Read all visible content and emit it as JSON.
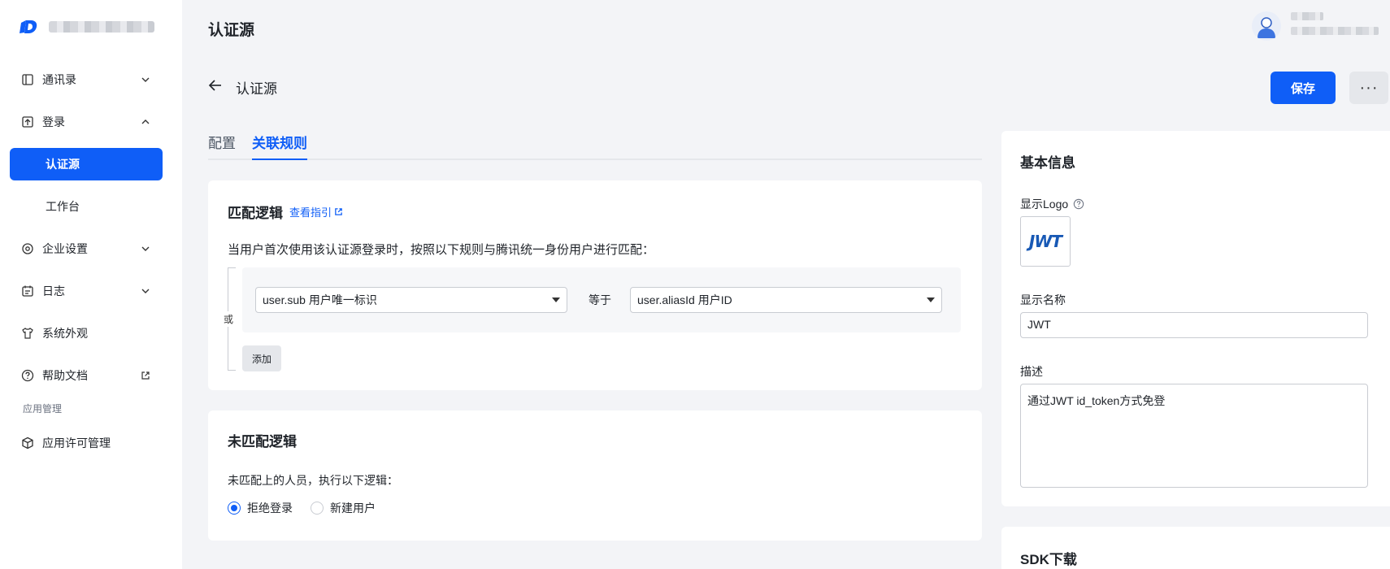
{
  "sidebar": {
    "items": [
      {
        "label": "通讯录",
        "icon": "contacts-icon"
      },
      {
        "label": "登录",
        "icon": "login-icon"
      },
      {
        "label": "认证源"
      },
      {
        "label": "工作台"
      },
      {
        "label": "企业设置",
        "icon": "settings-icon"
      },
      {
        "label": "日志",
        "icon": "log-icon"
      },
      {
        "label": "系统外观",
        "icon": "appearance-icon"
      },
      {
        "label": "帮助文档",
        "icon": "help-icon"
      }
    ],
    "group_label": "应用管理",
    "group_items": [
      {
        "label": "应用许可管理",
        "icon": "license-icon"
      }
    ]
  },
  "header": {
    "title": "认证源"
  },
  "page": {
    "back_title": "认证源",
    "save_label": "保存",
    "more_label": "···",
    "tabs": [
      {
        "label": "配置",
        "active": false
      },
      {
        "label": "关联规则",
        "active": true
      }
    ]
  },
  "match": {
    "title": "匹配逻辑",
    "guide_label": "查看指引",
    "description": "当用户首次使用该认证源登录时，按照以下规则与腾讯统一身份用户进行匹配：",
    "or_label": "或",
    "left_field": "user.sub 用户唯一标识",
    "operator": "等于",
    "right_field": "user.aliasId 用户ID",
    "add_label": "添加"
  },
  "nomatch": {
    "title": "未匹配逻辑",
    "description": "未匹配上的人员，执行以下逻辑：",
    "options": [
      {
        "label": "拒绝登录",
        "checked": true
      },
      {
        "label": "新建用户",
        "checked": false
      }
    ]
  },
  "basic": {
    "title": "基本信息",
    "logo_label": "显示Logo",
    "logo_text": "JWT",
    "name_label": "显示名称",
    "name_value": "JWT",
    "desc_label": "描述",
    "desc_value": "通过JWT id_token方式免登"
  },
  "sdk": {
    "title": "SDK下载"
  },
  "colors": {
    "primary": "#0f5ef7",
    "background": "#f3f4f7"
  }
}
